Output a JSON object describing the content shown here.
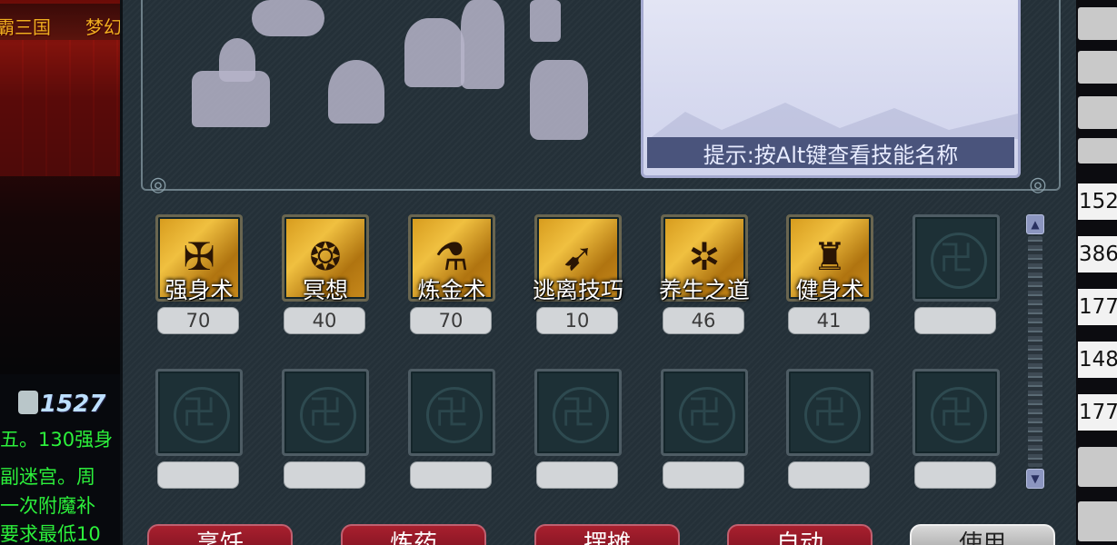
{
  "left_scene": {
    "tabs": [
      "霸三国",
      "梦幻"
    ],
    "chat_badge": "1527",
    "chat_lines": [
      "五。130强身",
      "副迷宫。周",
      "一次附魔补",
      "要求最低10"
    ]
  },
  "tip": {
    "text": "提示:按Alt键查看技能名称"
  },
  "skills": [
    {
      "name": "强身术",
      "level": "70",
      "glyph": "✠"
    },
    {
      "name": "冥想",
      "level": "40",
      "glyph": "❂"
    },
    {
      "name": "炼金术",
      "level": "70",
      "glyph": "⚗"
    },
    {
      "name": "逃离技巧",
      "level": "10",
      "glyph": "➹"
    },
    {
      "name": "养生之道",
      "level": "46",
      "glyph": "✲"
    },
    {
      "name": "健身术",
      "level": "41",
      "glyph": "♜"
    }
  ],
  "buttons": {
    "b1": "烹饪",
    "b2": "炼药",
    "b3": "摆摊",
    "b4": "自动",
    "b5": "使用"
  },
  "right_values": [
    "152",
    "386",
    "177",
    "148",
    "177"
  ],
  "colors": {
    "chat_green": "#2cf03b",
    "panel_bg": "#243038",
    "gold": "#f0c040",
    "tip_bar": "#4a547c",
    "button_red": "#a8202e"
  }
}
